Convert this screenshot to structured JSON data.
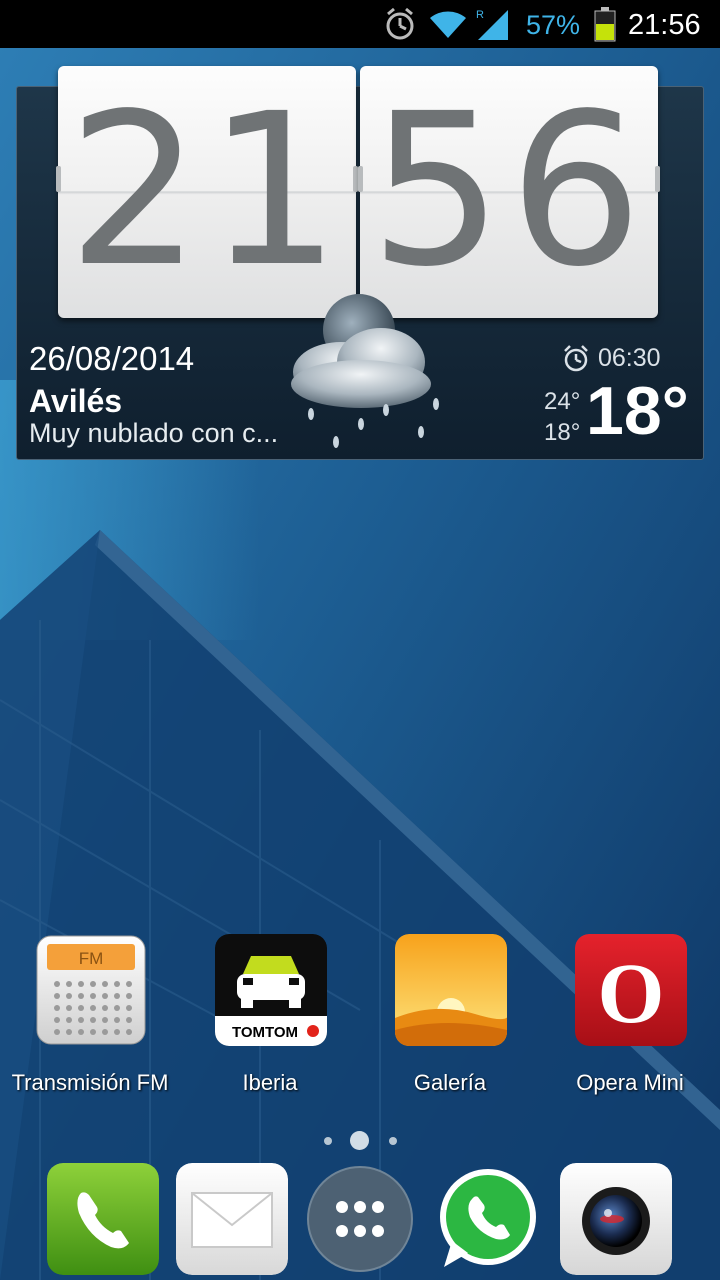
{
  "status_bar": {
    "icons": [
      "alarm-icon",
      "wifi-icon",
      "signal-roaming-icon",
      "battery-icon"
    ],
    "roaming_indicator": "R",
    "battery_percent": "57%",
    "battery_level": 0.57,
    "time": "21:56",
    "accent_color": "#3fb4e8"
  },
  "clock_widget": {
    "hours": "21",
    "minutes": "56",
    "date": "26/08/2014",
    "city": "Avilés",
    "condition": "Muy nublado con c...",
    "alarm_time": "06:30",
    "temp_high": "24°",
    "temp_low": "18°",
    "temp_current": "18°",
    "weather_icon": "rain-cloud-icon"
  },
  "apps": [
    {
      "label": "Transmisión FM",
      "icon": "fm-radio-icon",
      "badge_text": "FM"
    },
    {
      "label": "Iberia",
      "icon": "tomtom-car-icon",
      "badge_text": "TOMTOM"
    },
    {
      "label": "Galería",
      "icon": "sunset-gallery-icon"
    },
    {
      "label": "Opera Mini",
      "icon": "opera-icon",
      "badge_text": "O"
    }
  ],
  "page_indicator": {
    "pages": 3,
    "current": 2
  },
  "dock": [
    {
      "icon": "phone-icon"
    },
    {
      "icon": "messaging-icon"
    },
    {
      "icon": "app-drawer-icon"
    },
    {
      "icon": "whatsapp-icon"
    },
    {
      "icon": "camera-icon"
    }
  ]
}
